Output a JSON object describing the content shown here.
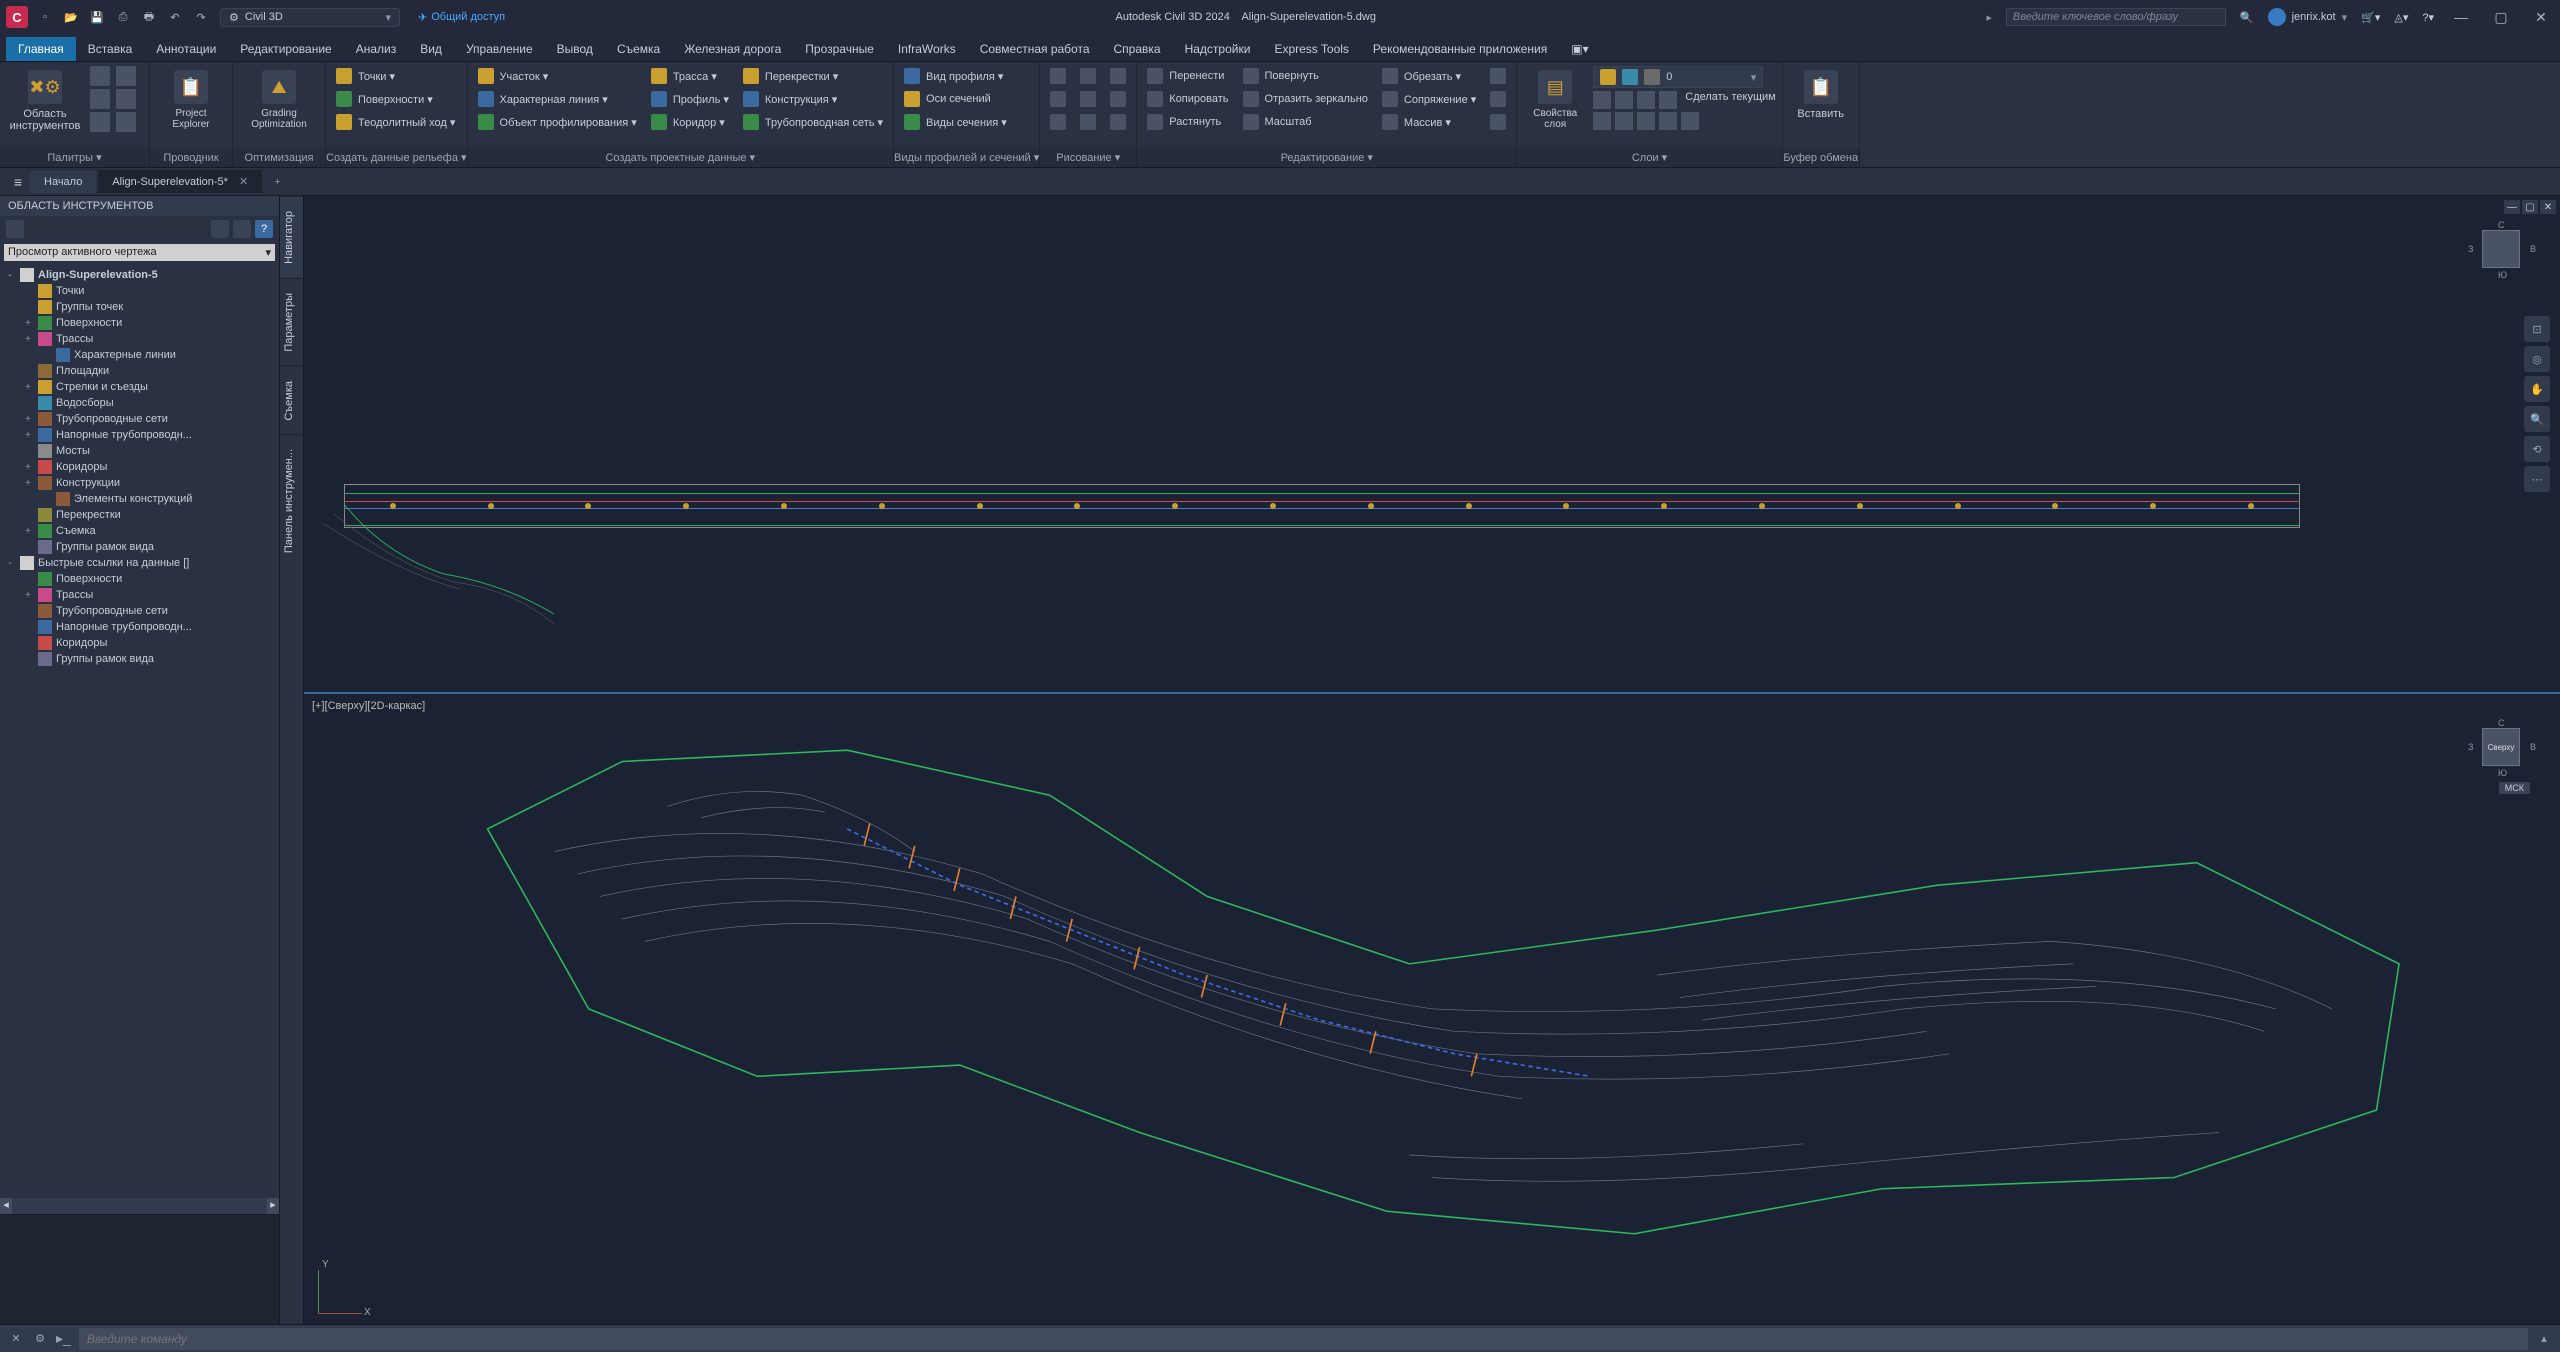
{
  "titlebar": {
    "app_letter": "C",
    "workspace": "Civil 3D",
    "share": "Общий доступ",
    "app_name": "Autodesk Civil 3D 2024",
    "doc_name": "Align-Superelevation-5.dwg",
    "search_placeholder": "Введите ключевое слово/фразу",
    "user": "jenrix.kot"
  },
  "ribbon_tabs": [
    "Главная",
    "Вставка",
    "Аннотации",
    "Редактирование",
    "Анализ",
    "Вид",
    "Управление",
    "Вывод",
    "Съемка",
    "Железная дорога",
    "Прозрачные",
    "InfraWorks",
    "Совместная работа",
    "Справка",
    "Надстройки",
    "Express Tools",
    "Рекомендованные приложения"
  ],
  "ribbon_active": 0,
  "ribbon": {
    "panel1": {
      "big": "Область инструментов",
      "title": "Палитры ▾"
    },
    "panel2": {
      "big1": "Project Explorer",
      "big2": "Grading Optimization",
      "title1": "Проводник",
      "title2": "Оптимизация"
    },
    "panel3": {
      "items": [
        "Точки ▾",
        "Поверхности ▾",
        "Теодолитный ход ▾"
      ],
      "title": "Создать данные рельефа ▾"
    },
    "panel4": {
      "col1": [
        "Участок ▾",
        "Характерная линия ▾",
        "Объект профилирования ▾"
      ],
      "col2": [
        "Трасса ▾",
        "Профиль ▾",
        "Коридор ▾"
      ],
      "col3": [
        "Перекрестки ▾",
        "Конструкция ▾",
        "Трубопроводная сеть ▾"
      ],
      "title": "Создать проектные данные ▾"
    },
    "panel5": {
      "items": [
        "Вид профиля ▾",
        "Оси сечений",
        "Виды сечения ▾"
      ],
      "title": "Виды профилей и сечений ▾"
    },
    "panel6": {
      "col1": [
        "Перенести",
        "Копировать",
        "Растянуть"
      ],
      "col2": [
        "Повернуть",
        "Отразить зеркально",
        "Масштаб"
      ],
      "col3": [
        "Обрезать ▾",
        "Сопряжение ▾",
        "Массив ▾"
      ],
      "title": "Редактирование ▾",
      "drawtitle": "Рисование ▾"
    },
    "panel7": {
      "big": "Свойства слоя",
      "title": "Слои ▾",
      "make_current": "Сделать текущим"
    },
    "panel8": {
      "big": "Вставить",
      "title": "Буфер обмена"
    }
  },
  "filetabs": {
    "start": "Начало",
    "active": "Align-Superelevation-5*"
  },
  "toolspace": {
    "title": "ОБЛАСТЬ ИНСТРУМЕНТОВ",
    "combo": "Просмотр активного чертежа",
    "tree": [
      {
        "d": 0,
        "exp": "-",
        "bold": true,
        "label": "Align-Superelevation-5",
        "icon": "#d0d0d0"
      },
      {
        "d": 1,
        "exp": "",
        "label": "Точки",
        "icon": "#c9a030"
      },
      {
        "d": 1,
        "exp": "",
        "label": "Группы точек",
        "icon": "#c9a030"
      },
      {
        "d": 1,
        "exp": "+",
        "label": "Поверхности",
        "icon": "#3a8a4a"
      },
      {
        "d": 1,
        "exp": "+",
        "label": "Трассы",
        "icon": "#c94a8a"
      },
      {
        "d": 2,
        "exp": "",
        "label": "Характерные линии",
        "icon": "#3a6aa0"
      },
      {
        "d": 1,
        "exp": "",
        "label": "Площадки",
        "icon": "#8a6a3a"
      },
      {
        "d": 1,
        "exp": "+",
        "label": "Стрелки и съезды",
        "icon": "#c9a030"
      },
      {
        "d": 1,
        "exp": "",
        "label": "Водосборы",
        "icon": "#3a8aaa"
      },
      {
        "d": 1,
        "exp": "+",
        "label": "Трубопроводные сети",
        "icon": "#8a5a3a"
      },
      {
        "d": 1,
        "exp": "+",
        "label": "Напорные трубопроводн...",
        "icon": "#3a6aa0"
      },
      {
        "d": 1,
        "exp": "",
        "label": "Мосты",
        "icon": "#8a8a8a"
      },
      {
        "d": 1,
        "exp": "+",
        "label": "Коридоры",
        "icon": "#c94a4a"
      },
      {
        "d": 1,
        "exp": "+",
        "label": "Конструкции",
        "icon": "#8a5a3a"
      },
      {
        "d": 2,
        "exp": "",
        "label": "Элементы конструкций",
        "icon": "#8a5a3a"
      },
      {
        "d": 1,
        "exp": "",
        "label": "Перекрестки",
        "icon": "#8a8a3a"
      },
      {
        "d": 1,
        "exp": "+",
        "label": "Съемка",
        "icon": "#3a8a4a"
      },
      {
        "d": 1,
        "exp": "",
        "label": "Группы рамок вида",
        "icon": "#6a6a8a"
      },
      {
        "d": 0,
        "exp": "-",
        "label": "Быстрые ссылки на данные []",
        "icon": "#d0d0d0"
      },
      {
        "d": 1,
        "exp": "",
        "label": "Поверхности",
        "icon": "#3a8a4a"
      },
      {
        "d": 1,
        "exp": "+",
        "label": "Трассы",
        "icon": "#c94a8a"
      },
      {
        "d": 1,
        "exp": "",
        "label": "Трубопроводные сети",
        "icon": "#8a5a3a"
      },
      {
        "d": 1,
        "exp": "",
        "label": "Напорные трубопроводн...",
        "icon": "#3a6aa0"
      },
      {
        "d": 1,
        "exp": "",
        "label": "Коридоры",
        "icon": "#c94a4a"
      },
      {
        "d": 1,
        "exp": "",
        "label": "Группы рамок вида",
        "icon": "#6a6a8a"
      }
    ],
    "vtabs": [
      "Навигатор",
      "Параметры",
      "Съемка",
      "Панель инструмен..."
    ]
  },
  "viewport": {
    "label_bottom": "[+][Сверху][2D-каркас]",
    "cube_top": "Сверху",
    "wcs": "МСК",
    "compass": {
      "n": "С",
      "s": "Ю",
      "e": "В",
      "w": "З"
    }
  },
  "cmdline": {
    "placeholder": "Введите команду"
  }
}
